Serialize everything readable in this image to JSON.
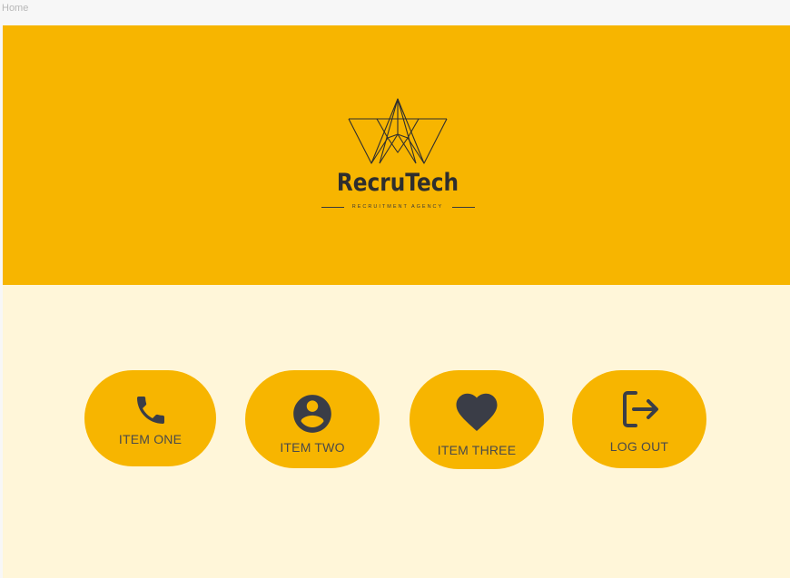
{
  "breadcrumb": {
    "label": "Home"
  },
  "brand": {
    "name": "RecruTech",
    "tagline": "RECRUITMENT AGENCY",
    "logo_icon": "geometric-mountain-logo"
  },
  "colors": {
    "accent": "#f7b500",
    "background": "#fff6d9",
    "icon": "#3a3d47"
  },
  "nav": {
    "items": [
      {
        "label": "ITEM ONE",
        "icon": "phone-icon"
      },
      {
        "label": "ITEM TWO",
        "icon": "account-circle-icon"
      },
      {
        "label": "ITEM THREE",
        "icon": "heart-icon"
      },
      {
        "label": "LOG OUT",
        "icon": "logout-icon"
      }
    ]
  }
}
